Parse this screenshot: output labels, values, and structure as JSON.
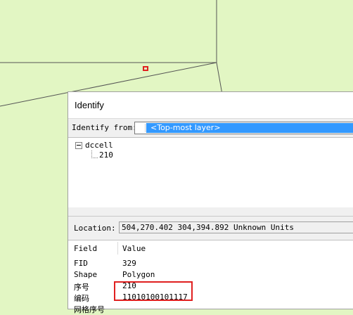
{
  "colors": {
    "map_background": "#e2f6c3",
    "map_lines": "#555555",
    "highlight": "#e02020",
    "selection": "#3399ff"
  },
  "dialog": {
    "title": "Identify",
    "identify_from_label": "Identify from:",
    "identify_from_value": "<Top-most layer>",
    "tree": {
      "root_label": "dccell",
      "child_label": "210"
    },
    "location_label": "Location:",
    "location_value": "504,270.402  304,394.892 Unknown Units",
    "table": {
      "headers": [
        "Field",
        "Value"
      ],
      "rows": [
        {
          "field": "FID",
          "value": "329"
        },
        {
          "field": "Shape",
          "value": "Polygon"
        },
        {
          "field": "序号",
          "value": "210"
        },
        {
          "field": "编码",
          "value": "11010100101117"
        },
        {
          "field": "网格序号",
          "value": ""
        }
      ]
    }
  }
}
